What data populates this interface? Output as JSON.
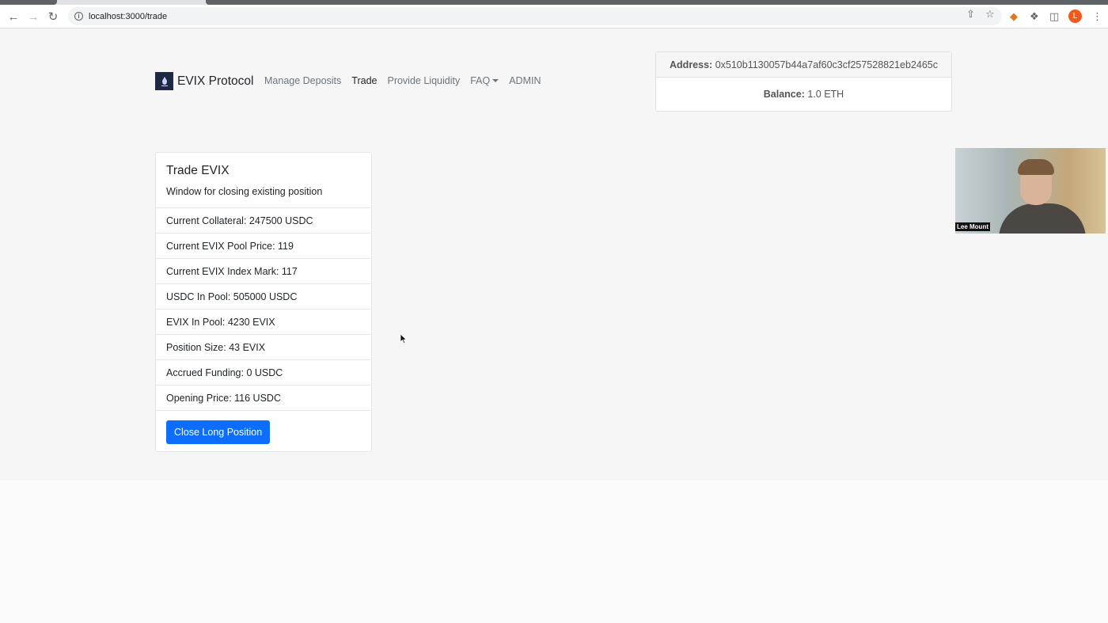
{
  "browser": {
    "url": "localhost:3000/trade",
    "icons": [
      "back-arrow-icon",
      "forward-arrow-icon",
      "reload-icon",
      "info-icon",
      "share-icon",
      "star-icon",
      "metamask-fox-icon",
      "puzzle-extension-icon",
      "side-panel-icon",
      "kebab-menu-icon"
    ],
    "profile_initial": "L"
  },
  "brand": {
    "name": "EVIX Protocol"
  },
  "nav": {
    "items": [
      {
        "label": "Manage Deposits"
      },
      {
        "label": "Trade"
      },
      {
        "label": "Provide Liquidity"
      },
      {
        "label": "FAQ"
      },
      {
        "label": "ADMIN"
      }
    ]
  },
  "wallet": {
    "address_label": "Address:",
    "address_value": "0x510b1130057b44a7af60c3cf257528821eb2465c",
    "balance_label": "Balance:",
    "balance_value": "1.0 ETH"
  },
  "card": {
    "title": "Trade EVIX",
    "subtitle": "Window for closing existing position",
    "rows": [
      {
        "text": "Current Collateral: 247500 USDC"
      },
      {
        "text": "Current EVIX Pool Price: 119"
      },
      {
        "text": "Current EVIX Index Mark: 117"
      },
      {
        "text": "USDC In Pool: 505000 USDC"
      },
      {
        "text": "EVIX In Pool: 4230 EVIX"
      },
      {
        "text": "Position Size: 43 EVIX"
      },
      {
        "text": "Accrued Funding: 0 USDC"
      },
      {
        "text": "Opening Price: 116 USDC"
      }
    ],
    "button_label": "Close Long Position"
  },
  "video": {
    "name": "Lee Mount"
  },
  "colors": {
    "primary": "#0d6efd",
    "brand_logo_bg": "#1c2844",
    "profile": "#f25a1d"
  }
}
